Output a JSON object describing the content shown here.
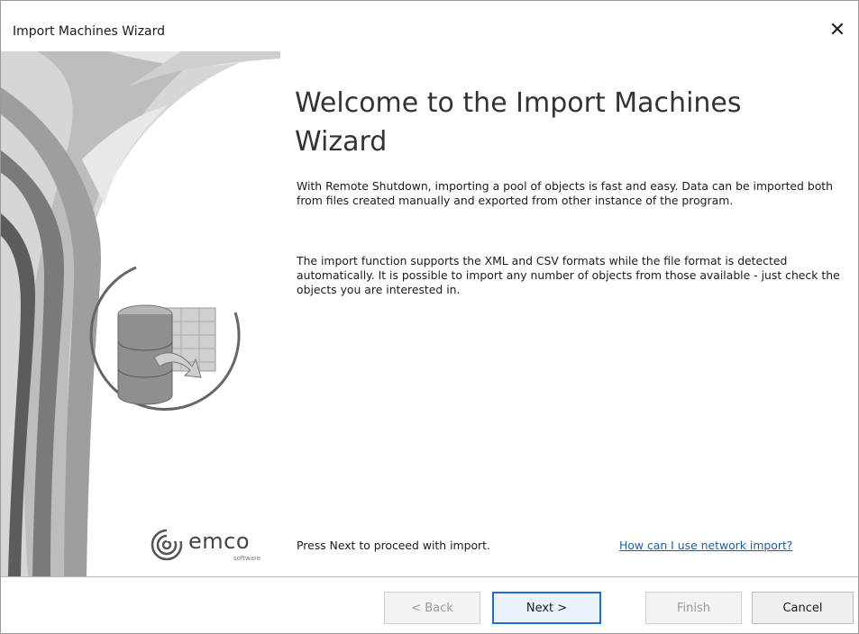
{
  "window": {
    "title": "Import Machines Wizard"
  },
  "icons": {
    "close": "close-icon",
    "database": "database-import-icon",
    "logo": "emco-logo-icon"
  },
  "welcome": {
    "heading": "Welcome to the Import Machines Wizard",
    "paragraph1": "With Remote Shutdown, importing a pool of objects is fast and easy. Data can be imported both from files created manually and exported from other instance of the program.",
    "paragraph2": "The import function supports the XML and CSV formats while the file format is detected automatically. It is possible to import any number of objects from those available - just check the objects you are interested in."
  },
  "logo": {
    "name": "emco",
    "sub": "software"
  },
  "footer": {
    "instruction": "Press Next to proceed with import.",
    "help_link": "How can I use network import?"
  },
  "buttons": {
    "back": "< Back",
    "next": "Next >",
    "finish": "Finish",
    "cancel": "Cancel"
  },
  "colors": {
    "link": "#1b5ea8",
    "primary_border": "#1c6fd1",
    "swoosh_dark": "#6e6e6e",
    "swoosh_light": "#d9d9d9"
  }
}
